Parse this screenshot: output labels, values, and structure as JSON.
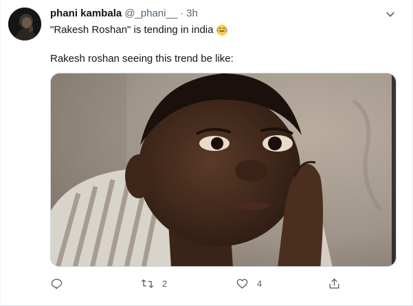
{
  "tweet": {
    "author": {
      "display_name": "phani kambala",
      "handle": "@_phani__",
      "separator": "·",
      "time": "3h"
    },
    "text_line1": "\"Rakesh Roshan\" is tending in india",
    "emoji": "face-with-tears-of-joy",
    "text_line2": "Rakesh roshan seeing this trend be like:",
    "media": {
      "alt": "Meme image of a boy resting his cheek on his hand, glancing sideways"
    },
    "actions": {
      "reply_count": "",
      "retweet_count": "2",
      "like_count": "4",
      "share_count": ""
    }
  },
  "colors": {
    "text_primary": "#0f1419",
    "text_secondary": "#536471",
    "border": "#cfd9de"
  },
  "icons": [
    "caret-down-icon",
    "reply-icon",
    "retweet-icon",
    "like-icon",
    "share-icon"
  ]
}
